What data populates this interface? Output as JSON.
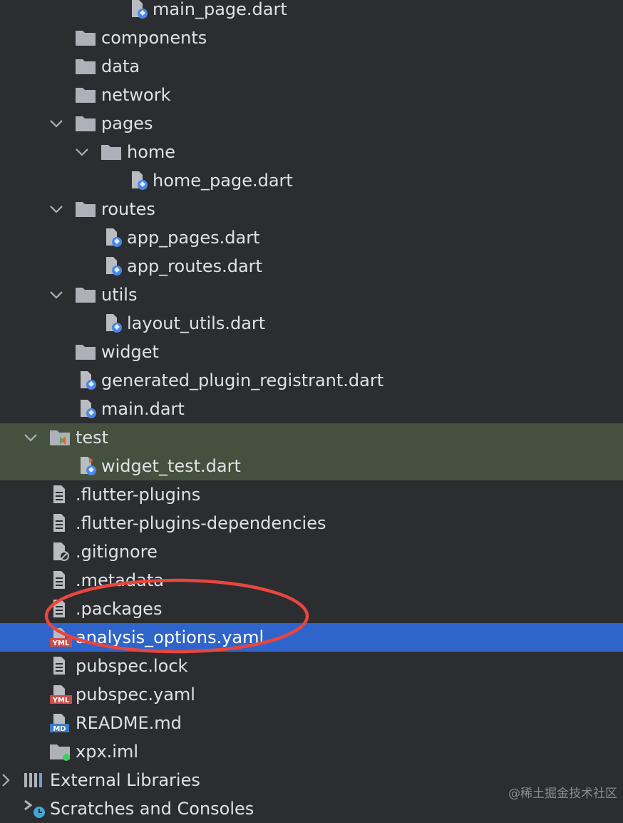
{
  "tree": {
    "items": [
      {
        "label": "main_page.dart",
        "type": "dart"
      },
      {
        "label": "components",
        "type": "folder"
      },
      {
        "label": "data",
        "type": "folder"
      },
      {
        "label": "network",
        "type": "folder"
      },
      {
        "label": "pages",
        "type": "folder",
        "expanded": true
      },
      {
        "label": "home",
        "type": "folder",
        "expanded": true
      },
      {
        "label": "home_page.dart",
        "type": "dart"
      },
      {
        "label": "routes",
        "type": "folder",
        "expanded": true
      },
      {
        "label": "app_pages.dart",
        "type": "dart"
      },
      {
        "label": "app_routes.dart",
        "type": "dart"
      },
      {
        "label": "utils",
        "type": "folder",
        "expanded": true
      },
      {
        "label": "layout_utils.dart",
        "type": "dart"
      },
      {
        "label": "widget",
        "type": "folder"
      },
      {
        "label": "generated_plugin_registrant.dart",
        "type": "dart"
      },
      {
        "label": "main.dart",
        "type": "dart"
      },
      {
        "label": "test",
        "type": "test-folder",
        "expanded": true
      },
      {
        "label": "widget_test.dart",
        "type": "dart-test"
      },
      {
        "label": ".flutter-plugins",
        "type": "text"
      },
      {
        "label": ".flutter-plugins-dependencies",
        "type": "text"
      },
      {
        "label": ".gitignore",
        "type": "ignore"
      },
      {
        "label": ".metadata",
        "type": "text"
      },
      {
        "label": ".packages",
        "type": "text"
      },
      {
        "label": "analysis_options.yaml",
        "type": "yaml",
        "selected": true
      },
      {
        "label": "pubspec.lock",
        "type": "text"
      },
      {
        "label": "pubspec.yaml",
        "type": "yaml"
      },
      {
        "label": "README.md",
        "type": "md"
      },
      {
        "label": "xpx.iml",
        "type": "iml"
      },
      {
        "label": "External Libraries",
        "type": "libraries",
        "collapsed": true
      },
      {
        "label": "Scratches and Consoles",
        "type": "scratches"
      }
    ]
  },
  "badges": {
    "yaml": "YML",
    "md": "MD"
  },
  "watermark": "@稀土掘金技术社区",
  "colors": {
    "background": "#2b2d30",
    "selection": "#2f65ca",
    "test_highlight": "#45503f",
    "annotation": "#e8463f",
    "folder": "#aeb1b7",
    "dart_blue": "#4a88e8"
  }
}
